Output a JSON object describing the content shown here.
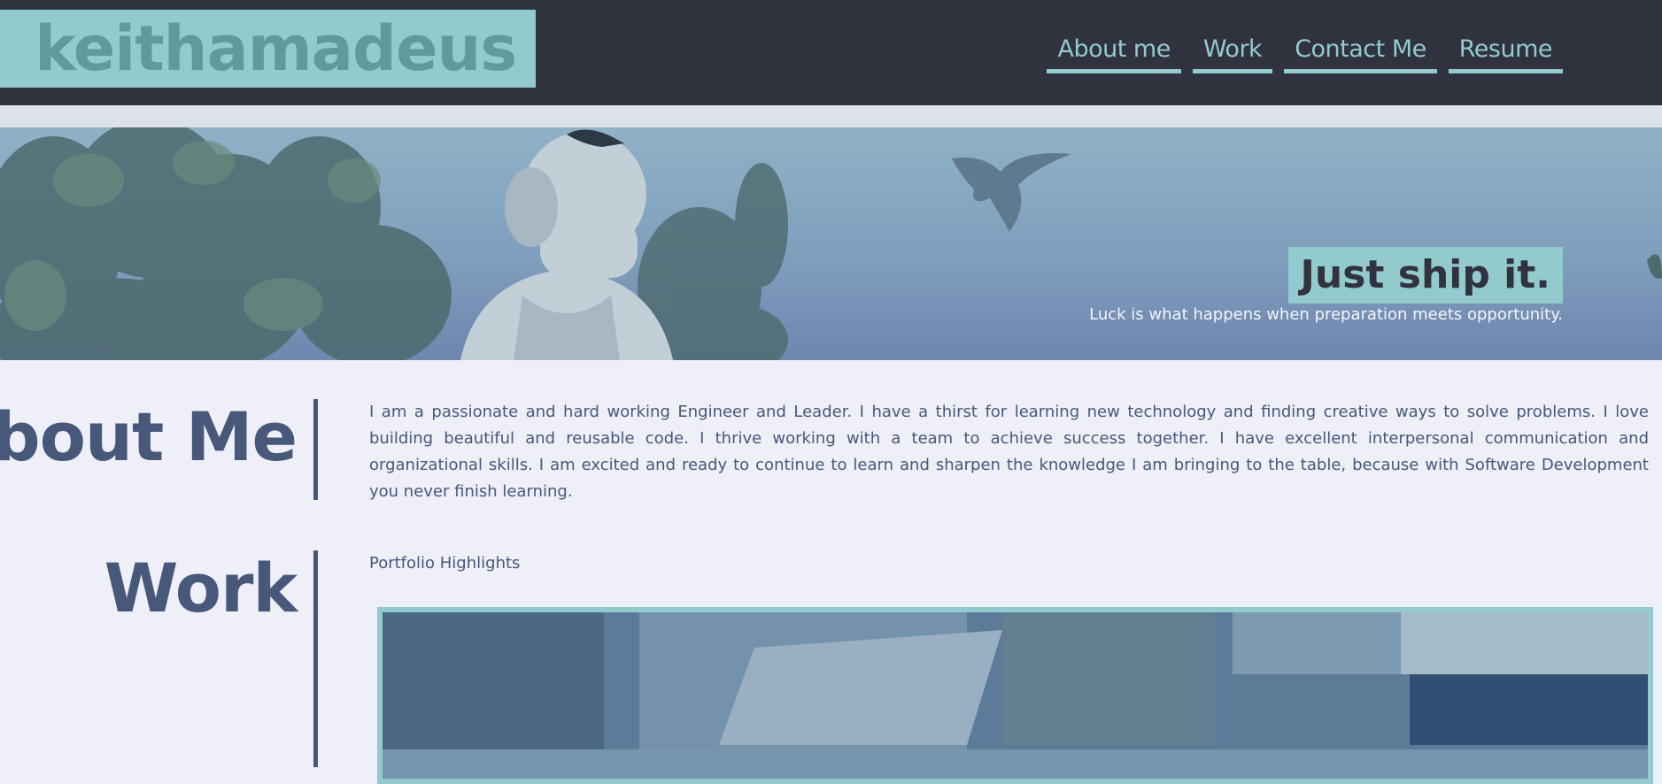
{
  "header": {
    "logo_text": "keithamadeus",
    "nav": [
      {
        "label": "About me"
      },
      {
        "label": "Work"
      },
      {
        "label": "Contact Me"
      },
      {
        "label": "Resume"
      }
    ]
  },
  "hero": {
    "tagline": "Just ship it.",
    "subtitle": "Luck is what happens when preparation meets opportunity."
  },
  "about": {
    "title": "About Me",
    "body": "I am a passionate and hard working Engineer and Leader. I have a thirst for learning new technology and finding creative ways to solve problems. I love building beautiful and reusable code. I thrive working with a team to achieve success together. I have excellent interpersonal communication and organizational skills. I am excited and ready to continue to learn and sharpen the knowledge I am bringing to the table, because with Software Development you never finish learning."
  },
  "work": {
    "title": "Work",
    "subtitle": "Portfolio Highlights"
  },
  "colors": {
    "header_bg": "#30333d",
    "accent_teal": "#93cace",
    "logo_text": "#5f9b9c",
    "section_text": "#47587a",
    "page_bg": "#eeeff7"
  }
}
